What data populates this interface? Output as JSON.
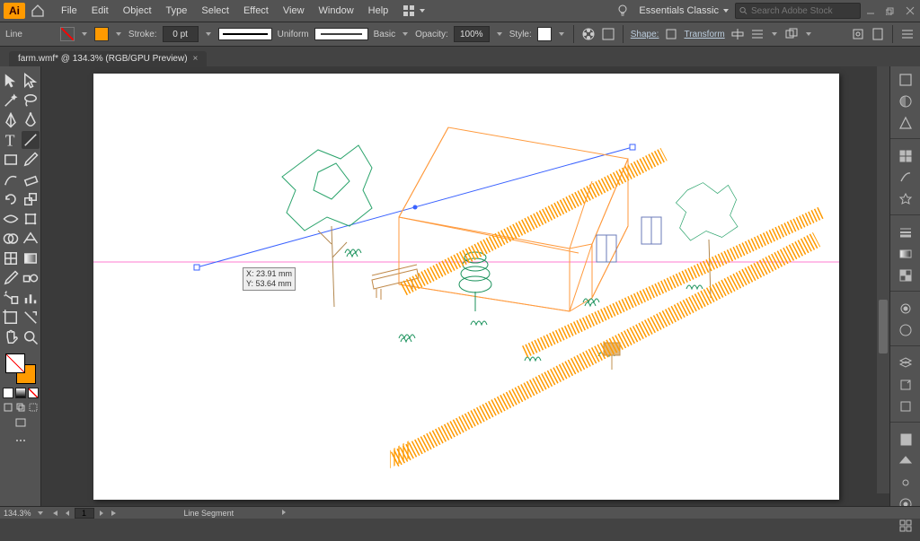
{
  "app": {
    "logo_text": "Ai"
  },
  "menu": {
    "items": [
      "File",
      "Edit",
      "Object",
      "Type",
      "Select",
      "Effect",
      "View",
      "Window",
      "Help"
    ]
  },
  "workspace": {
    "name": "Essentials Classic"
  },
  "search": {
    "placeholder": "Search Adobe Stock"
  },
  "controlbar": {
    "object_label": "Line",
    "stroke_label": "Stroke:",
    "stroke_weight": "0 pt",
    "profile_label": "Uniform",
    "brush_label": "Basic",
    "opacity_label": "Opacity:",
    "opacity_value": "100%",
    "style_label": "Style:",
    "shape_label": "Shape:",
    "transform_label": "Transform"
  },
  "document": {
    "tab_title": "farm.wmf* @ 134.3% (RGB/GPU Preview)"
  },
  "cursor_tip": {
    "x": "X: 23.91 mm",
    "y": "Y: 53.64 mm"
  },
  "status": {
    "zoom": "134.3%",
    "page": "1",
    "tool": "Line Segment"
  }
}
